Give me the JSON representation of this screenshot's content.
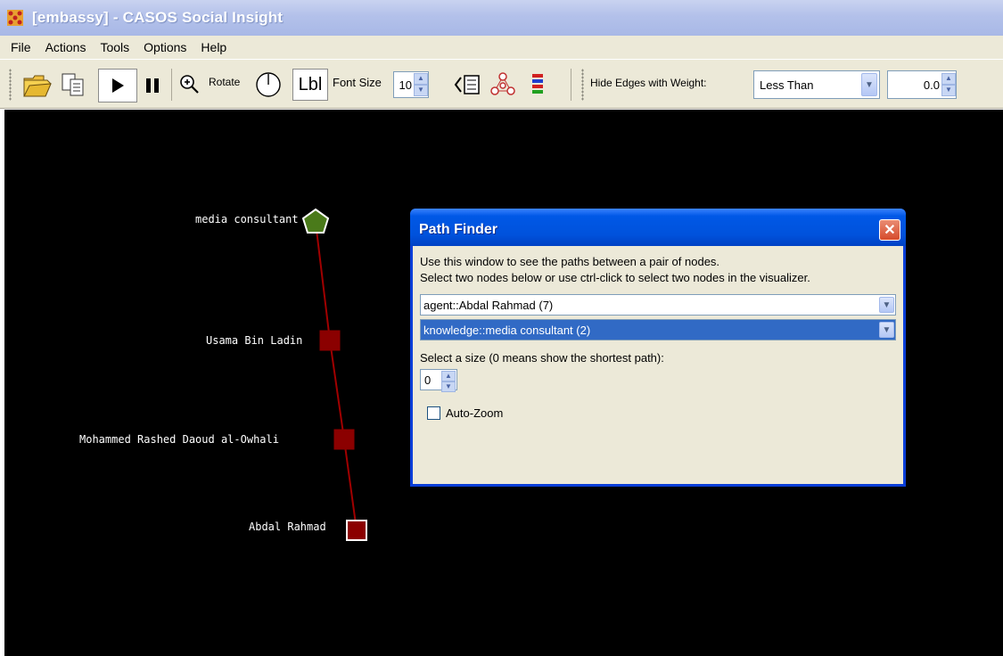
{
  "window": {
    "title": "[embassy] - CASOS Social Insight"
  },
  "menu": [
    "File",
    "Actions",
    "Tools",
    "Options",
    "Help"
  ],
  "toolbar": {
    "rotate_label": "Rotate",
    "lbl_label": "Lbl",
    "font_size_label": "Font Size",
    "font_size_value": "10",
    "hide_edges_label": "Hide Edges with Weight:",
    "hide_edges_mode": "Less Than",
    "hide_edges_value": "0.0"
  },
  "graph": {
    "nodes": [
      {
        "label": "media consultant",
        "shape": "pentagon",
        "color": "#4a7a1a"
      },
      {
        "label": "Usama Bin Ladin",
        "shape": "square",
        "color": "#8b0000"
      },
      {
        "label": "Mohammed Rashed Daoud al-Owhali",
        "shape": "square",
        "color": "#8b0000"
      },
      {
        "label": "Abdal Rahmad",
        "shape": "square",
        "color": "#8b0000"
      }
    ],
    "edge_color": "#a00000"
  },
  "dialog": {
    "title": "Path Finder",
    "instruction_line1": "Use this window to see the paths between a pair of nodes.",
    "instruction_line2": "Select two nodes below or use ctrl-click to select two nodes in the visualizer.",
    "node_a": "agent::Abdal Rahmad (7)",
    "node_b": "knowledge::media consultant (2)",
    "size_label": "Select a size (0 means show the shortest path):",
    "size_value": "0",
    "auto_zoom_label": "Auto-Zoom",
    "auto_zoom_checked": false
  }
}
